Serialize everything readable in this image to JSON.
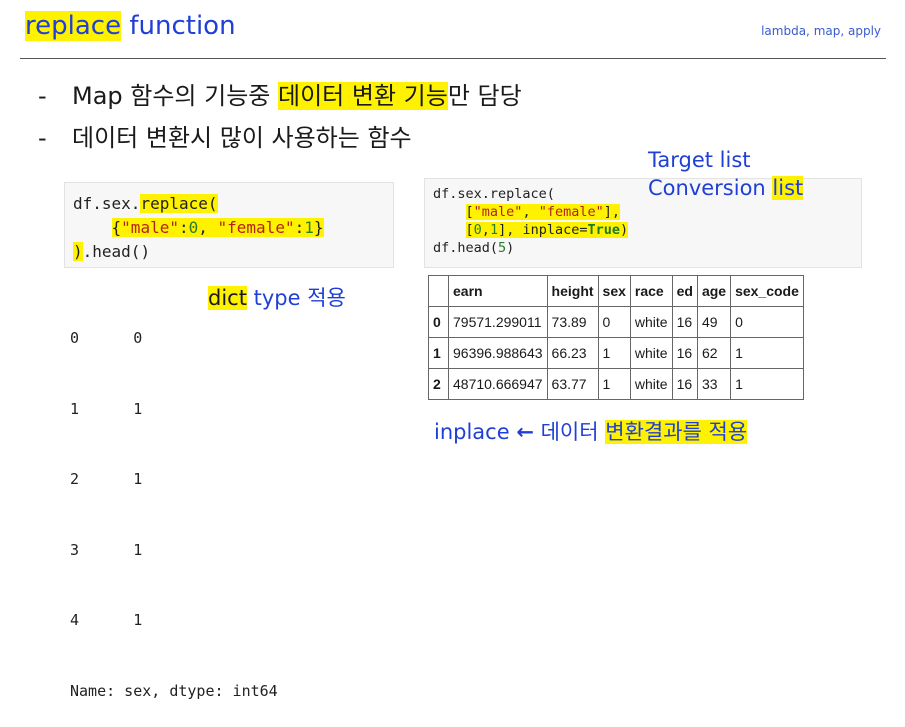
{
  "header": {
    "title_highlight": "replace",
    "title_rest": " function",
    "tag": "lambda, map, apply"
  },
  "bullets": [
    {
      "dash": "-",
      "pre": "Map 함수의 기능중 ",
      "highlight": "데이터 변환 기능",
      "post": "만 담당"
    },
    {
      "dash": "-",
      "text": "데이터 변환시 많이 사용하는 함수"
    }
  ],
  "code1": {
    "l1a": "df.sex.",
    "l1b": "replace(",
    "l2_indent": "    ",
    "l2_open": "{",
    "l2_k1": "\"male\"",
    "l2_c1": ":",
    "l2_v1": "0",
    "l2_sep": ", ",
    "l2_k2": "\"female\"",
    "l2_c2": ":",
    "l2_v2": "1",
    "l2_close": "}",
    "l3a": ")",
    "l3b": ".head()"
  },
  "output1": {
    "rows": [
      {
        "idx": "0",
        "val": "0"
      },
      {
        "idx": "1",
        "val": "1"
      },
      {
        "idx": "2",
        "val": "1"
      },
      {
        "idx": "3",
        "val": "1"
      },
      {
        "idx": "4",
        "val": "1"
      }
    ],
    "footer": "Name: sex, dtype: int64"
  },
  "annot_dict": {
    "hl": "dict",
    "rest": " type 적용"
  },
  "annot_target": {
    "text": "Target list"
  },
  "annot_conversion": {
    "pre": "Conversion ",
    "hl": "list"
  },
  "code2": {
    "l1": "df.sex.replace(",
    "l2_indent": "    ",
    "l2_open": "[",
    "l2_s1": "\"male\"",
    "l2_sep": ", ",
    "l2_s2": "\"female\"",
    "l2_close": "],",
    "l3_indent": "    ",
    "l3_open": "[",
    "l3_n1": "0",
    "l3_comma": ",",
    "l3_n2": "1",
    "l3_mid": "], inplace=",
    "l3_kw": "True",
    "l3_close": ")",
    "l4a": "df.head(",
    "l4n": "5",
    "l4b": ")"
  },
  "table": {
    "columns": [
      "",
      "earn",
      "height",
      "sex",
      "race",
      "ed",
      "age",
      "sex_code"
    ],
    "rows": [
      [
        "0",
        "79571.299011",
        "73.89",
        "0",
        "white",
        "16",
        "49",
        "0"
      ],
      [
        "1",
        "96396.988643",
        "66.23",
        "1",
        "white",
        "16",
        "62",
        "1"
      ],
      [
        "2",
        "48710.666947",
        "63.77",
        "1",
        "white",
        "16",
        "33",
        "1"
      ]
    ]
  },
  "annot_inplace": {
    "pre": "inplace ",
    "arrow": "←",
    "mid": " 데이터 ",
    "hl": "변환결과를 적용"
  },
  "colors": {
    "highlight": "#fff200",
    "accent_blue": "#1f3fd6",
    "string_red": "#b5221b",
    "number_green": "#2a7d2a"
  }
}
